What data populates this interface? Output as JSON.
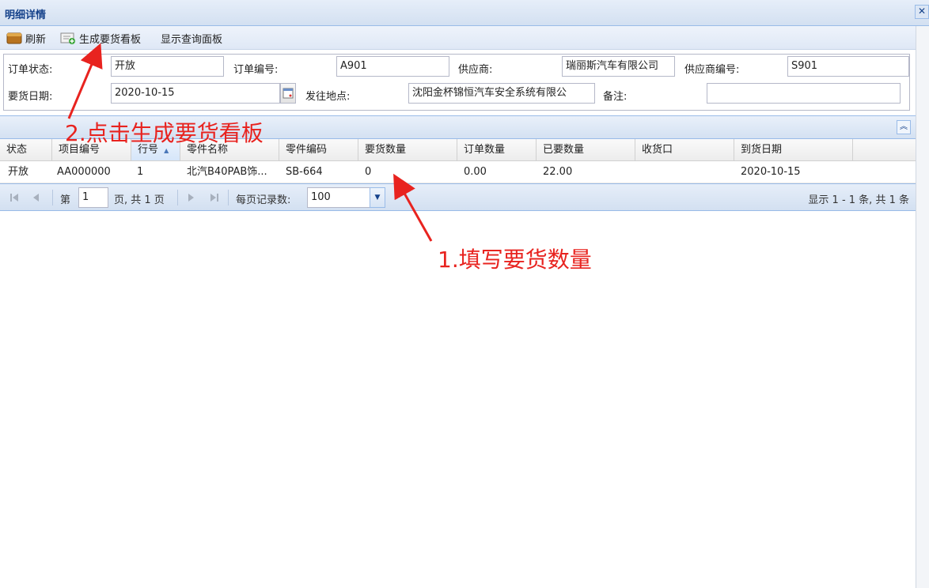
{
  "window": {
    "title": "明细详情",
    "close_glyph": "✕"
  },
  "toolbar": {
    "refresh_label": "刷新",
    "generate_label": "生成要货看板",
    "show_query_label": "显示查询面板"
  },
  "form": {
    "order_status_label": "订单状态:",
    "order_status_value": "开放",
    "order_no_label": "订单编号:",
    "order_no_value": "A901",
    "supplier_label": "供应商:",
    "supplier_value": "瑞丽斯汽车有限公司",
    "supplier_code_label": "供应商编号:",
    "supplier_code_value": "S901",
    "request_date_label": "要货日期:",
    "request_date_value": "2020-10-15",
    "ship_to_label": "发往地点:",
    "ship_to_value": "沈阳金杯锦恒汽车安全系统有限公",
    "remark_label": "备注:",
    "remark_value": ""
  },
  "grid": {
    "columns": [
      "状态",
      "项目编号",
      "行号",
      "零件名称",
      "零件编码",
      "要货数量",
      "订单数量",
      "已要数量",
      "收货口",
      "到货日期"
    ],
    "sort_indicator": "▲",
    "rows": [
      [
        "开放",
        "AA000000",
        "1",
        "北汽B40PAB饰...",
        "SB-664",
        "0",
        "0.00",
        "22.00",
        "",
        "2020-10-15"
      ]
    ]
  },
  "pager": {
    "page_prefix": "第",
    "page_value": "1",
    "page_suffix": "页, 共 1 页",
    "per_page_label": "每页记录数:",
    "per_page_value": "100",
    "summary": "显示 1 - 1 条, 共 1 条"
  },
  "annotations": {
    "step1": "1.填写要货数量",
    "step2": "2.点击生成要货看板",
    "color": "#e8231f"
  }
}
